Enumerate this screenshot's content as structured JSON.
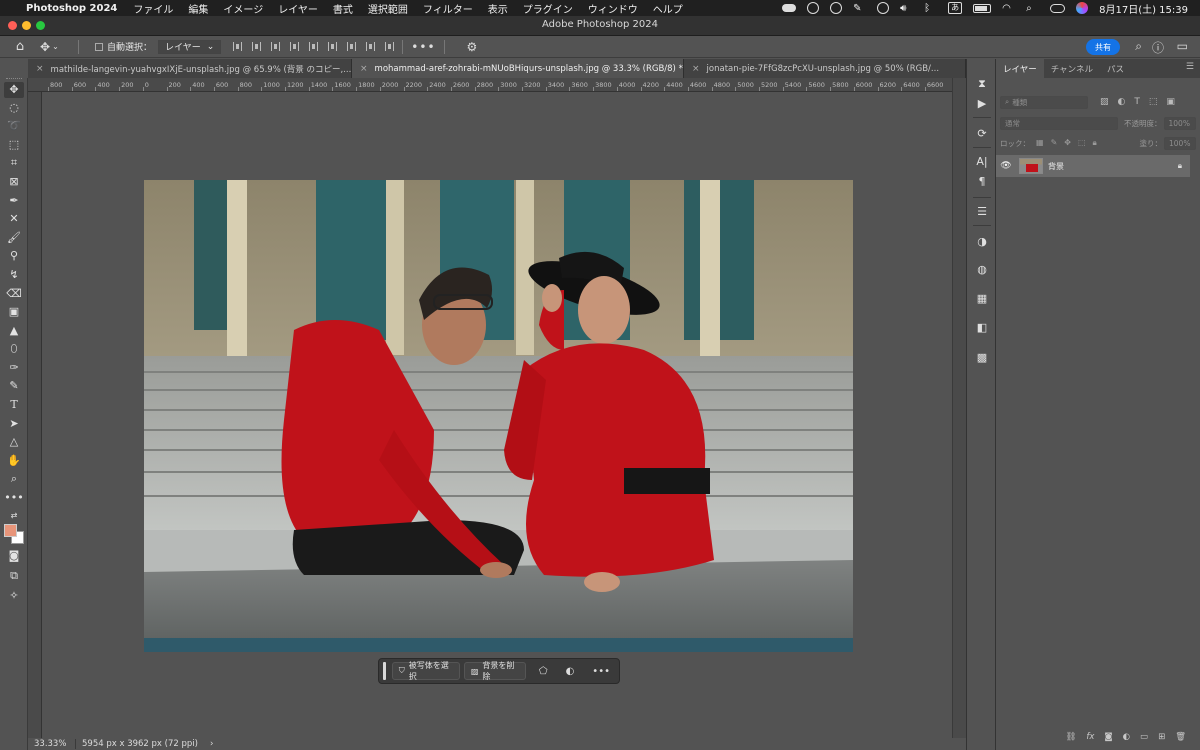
{
  "menubar": {
    "app_name": "Photoshop 2024",
    "items": [
      "ファイル",
      "編集",
      "イメージ",
      "レイヤー",
      "書式",
      "選択範囲",
      "フィルター",
      "表示",
      "プラグイン",
      "ウィンドウ",
      "ヘルプ"
    ],
    "input_source": "あ",
    "datetime": "8月17日(土)  15:39"
  },
  "window": {
    "title": "Adobe Photoshop 2024"
  },
  "options_bar": {
    "auto_select_label": "自動選択：",
    "auto_select_value": "レイヤー",
    "share_label": "共有"
  },
  "tabs": [
    {
      "label": "mathilde-langevin-yuahvgxIXjE-unsplash.jpg @ 65.9% (背景 のコピー,...",
      "active": false
    },
    {
      "label": "mohammad-aref-zohrabi-mNUoBHiqurs-unsplash.jpg @ 33.3% (RGB/8) *",
      "active": true
    },
    {
      "label": "jonatan-pie-7FfG8zcPcXU-unsplash.jpg @ 50% (RGB/...",
      "active": false
    }
  ],
  "ruler": {
    "labels": [
      "800",
      "600",
      "400",
      "200",
      "0",
      "200",
      "400",
      "600",
      "800",
      "1000",
      "1200",
      "1400",
      "1600",
      "1800",
      "2000",
      "2200",
      "2400",
      "2600",
      "2800",
      "3000",
      "3200",
      "3400",
      "3600",
      "3800",
      "4000",
      "4200",
      "4400",
      "4600",
      "4800",
      "5000",
      "5200",
      "5400",
      "5600",
      "5800",
      "6000",
      "6200",
      "6400",
      "6600"
    ]
  },
  "taskbar": {
    "select_subject_label": "被写体を選択",
    "remove_bg_label": "背景を削除"
  },
  "status": {
    "zoom": "33.33%",
    "dimensions": "5954 px x 3962 px (72 ppi)",
    "chevron": "›"
  },
  "layers_panel": {
    "tabs": [
      "レイヤー",
      "チャンネル",
      "パス"
    ],
    "filter_placeholder": "種類",
    "blend_mode": "通常",
    "opacity_label": "不透明度：",
    "opacity_value": "100%",
    "lock_label": "ロック：",
    "fill_label": "塗り：",
    "fill_value": "100%",
    "layer_name": "背景"
  },
  "colors": {
    "foreground": "#e8957a",
    "background": "#ffffff",
    "share_button": "#1473e6",
    "red_clothing": "#c0121a"
  }
}
